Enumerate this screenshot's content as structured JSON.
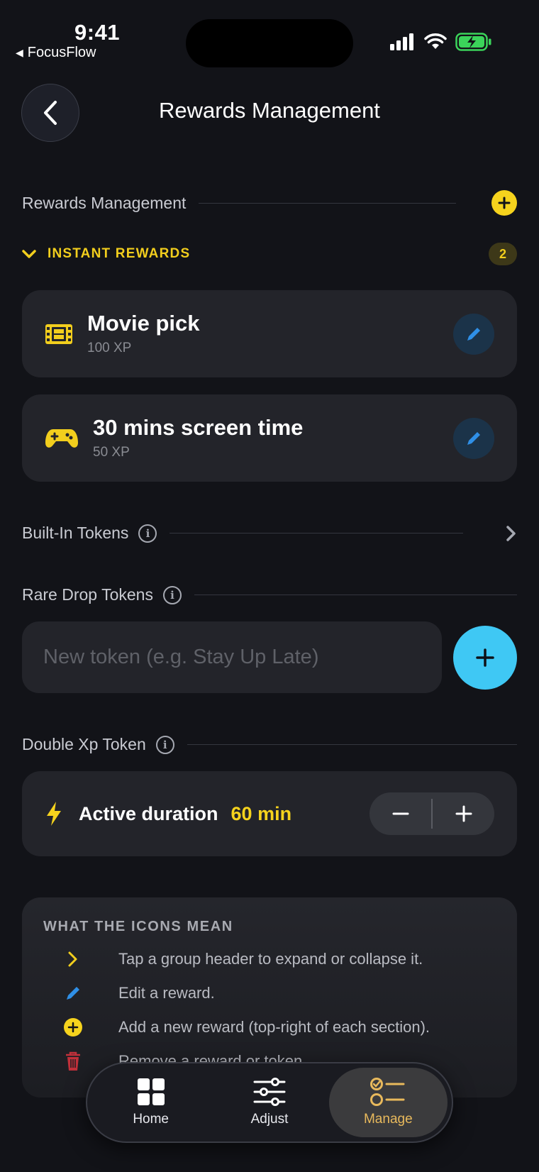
{
  "status_bar": {
    "time": "9:41",
    "back_app": "FocusFlow"
  },
  "header": {
    "title": "Rewards Management"
  },
  "rewards_section": {
    "label": "Rewards Management",
    "group": {
      "title": "INSTANT REWARDS",
      "count": "2"
    },
    "items": [
      {
        "name": "Movie pick",
        "xp": "100 XP",
        "icon": "film-icon"
      },
      {
        "name": "30 mins screen time",
        "xp": "50 XP",
        "icon": "gamepad-icon"
      }
    ]
  },
  "built_in": {
    "label": "Built-In Tokens"
  },
  "rare_drop": {
    "label": "Rare Drop Tokens",
    "placeholder": "New token (e.g. Stay Up Late)"
  },
  "double_xp": {
    "label": "Double Xp Token",
    "duration_label": "Active duration",
    "duration_value": "60 min"
  },
  "legend": {
    "title": "WHAT THE ICONS MEAN",
    "rows": [
      {
        "icon": "chevron-right-icon",
        "text": "Tap a group header to expand or collapse it."
      },
      {
        "icon": "pencil-icon",
        "text": "Edit a reward."
      },
      {
        "icon": "plus-circle-icon",
        "text": "Add a new reward (top-right of each section)."
      },
      {
        "icon": "trash-icon",
        "text": "Remove a reward or token."
      }
    ]
  },
  "nav": [
    {
      "label": "Home",
      "icon": "grid-icon"
    },
    {
      "label": "Adjust",
      "icon": "sliders-icon"
    },
    {
      "label": "Manage",
      "icon": "checklist-icon",
      "active": true
    }
  ],
  "colors": {
    "accent_yellow": "#f6d31d",
    "accent_cyan": "#3fc8f4",
    "edit_blue": "#2f8fe6",
    "manage_gold": "#e8b95c",
    "danger_red": "#c0303a"
  }
}
